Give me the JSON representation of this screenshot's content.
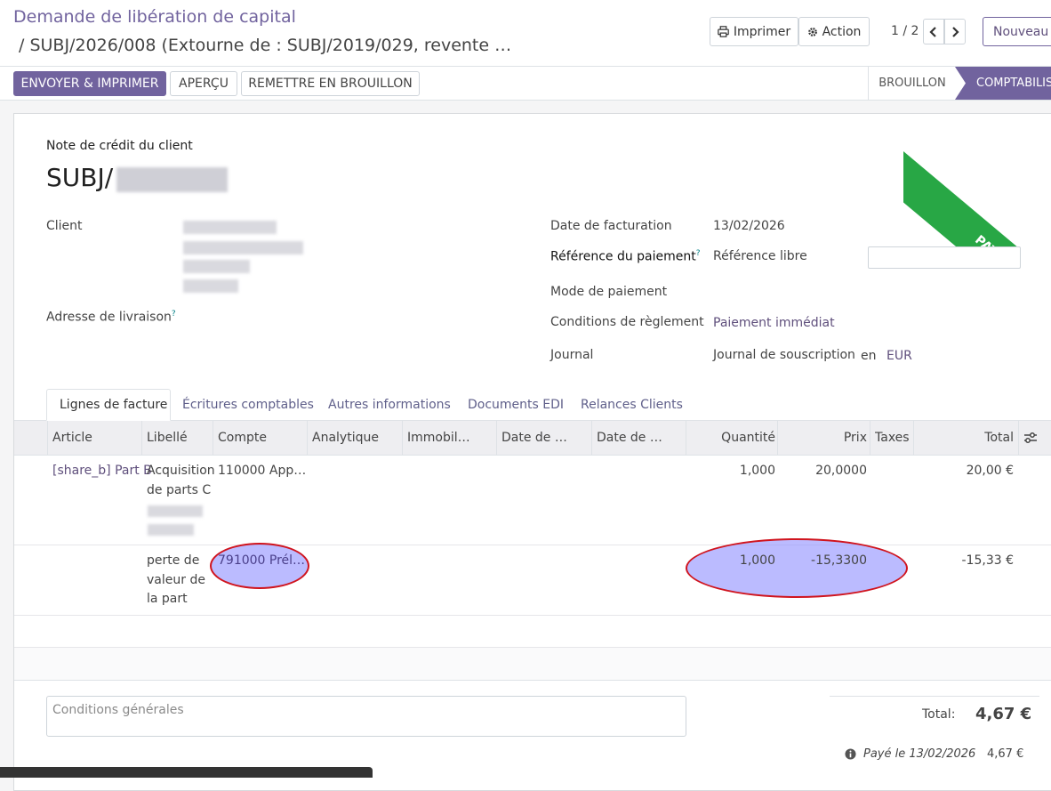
{
  "breadcrumb": {
    "parent": "Demande de libération de capital",
    "current": "/ SUBJ/2026/008 (Extourne de : SUBJ/2019/029, revente …"
  },
  "control": {
    "print_label": "Imprimer",
    "action_label": "Action",
    "pager": "1 / 2",
    "new_label": "Nouveau"
  },
  "actions": {
    "send_print": "ENVOYER & IMPRIMER",
    "preview": "APERÇU",
    "reset_draft": "REMETTRE EN BROUILLON"
  },
  "status": {
    "draft": "BROUILLON",
    "posted": "COMPTABILISÉ"
  },
  "ribbon": "PAYÉ",
  "form": {
    "doc_type": "Note de crédit du client",
    "name_prefix": "SUBJ/",
    "client_label": "Client",
    "delivery_label": "Adresse de livraison",
    "help_mark": "?",
    "invoice_date_label": "Date de facturation",
    "invoice_date": "13/02/2026",
    "payment_ref_label": "Référence du paiement",
    "payment_ref_value": "Référence libre",
    "payment_mode_label": "Mode de paiement",
    "payment_terms_label": "Conditions de règlement",
    "payment_terms": "Paiement immédiat",
    "journal_label": "Journal",
    "journal": "Journal de souscription",
    "currency_prefix": "en",
    "currency": "EUR"
  },
  "tabs": [
    "Lignes de facture",
    "Écritures comptables",
    "Autres informations",
    "Documents EDI",
    "Relances Clients"
  ],
  "table": {
    "columns": {
      "article": "Article",
      "libelle": "Libellé",
      "compte": "Compte",
      "analytique": "Analytique",
      "immobil": "Immobil…",
      "date1": "Date de …",
      "date2": "Date de …",
      "quantite": "Quantité",
      "prix": "Prix",
      "taxes": "Taxes",
      "total": "Total"
    },
    "rows": [
      {
        "article": "[share_b] Part B",
        "libelle_1": "Acquisition",
        "libelle_2": "de parts C",
        "compte": "110000 App…",
        "quantite": "1,000",
        "prix": "20,0000",
        "total": "20,00 €"
      },
      {
        "article": "",
        "libelle_1": "perte de",
        "libelle_2": "valeur de",
        "libelle_3": "la part",
        "compte": "791000 Prél…",
        "quantite": "1,000",
        "prix": "-15,3300",
        "total": "-15,33 €"
      }
    ]
  },
  "footer": {
    "terms_placeholder": "Conditions générales",
    "total_label": "Total:",
    "total": "4,67 €",
    "paid_text": "Payé le 13/02/2026",
    "paid_amount": "4,67 €"
  },
  "colors": {
    "accent": "#71639e",
    "paid_ribbon": "#28a745",
    "annotation": "#d0141e"
  }
}
